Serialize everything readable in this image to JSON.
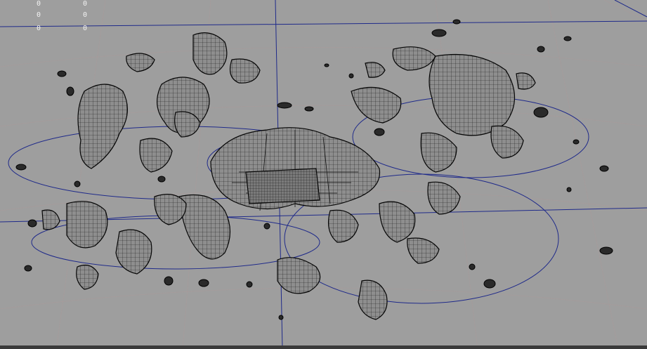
{
  "hud": {
    "readouts": [
      {
        "left": "0",
        "right": "0"
      },
      {
        "left": "0",
        "right": "0"
      },
      {
        "left": "0",
        "right": "0"
      }
    ]
  },
  "colors": {
    "viewport_bg": "#9e9e9e",
    "wireframe": "#111111",
    "guide_lines": "#1f2a8a",
    "grid": "#a99a9a",
    "hud_text": "#f2f2f2"
  }
}
